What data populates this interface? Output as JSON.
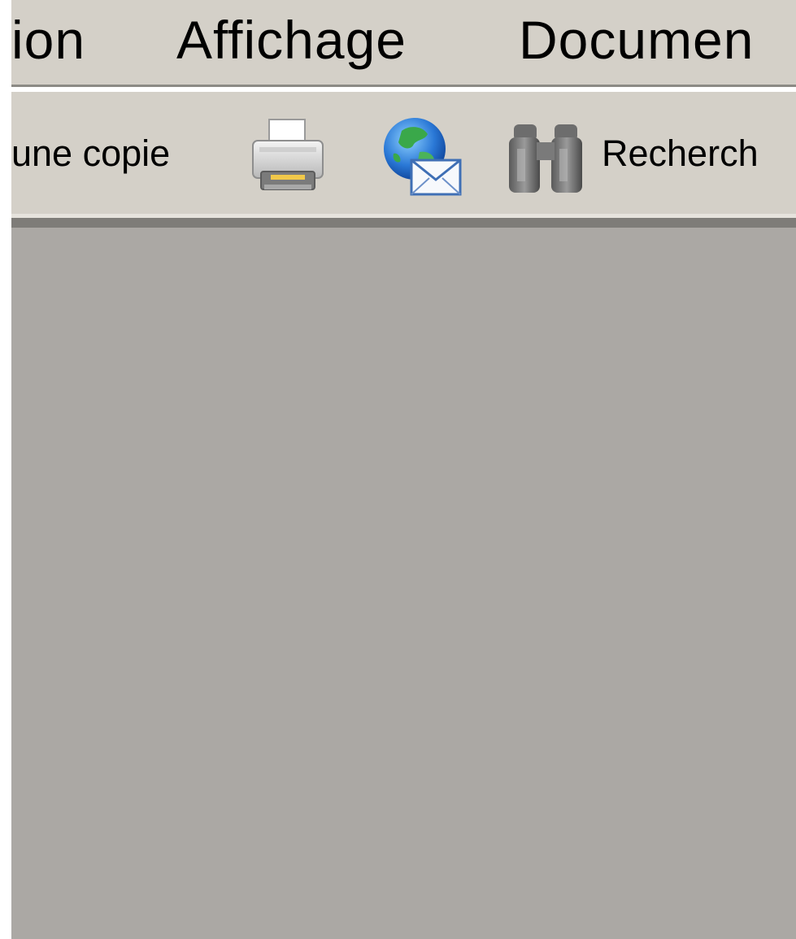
{
  "menubar": {
    "items": [
      {
        "label": "ion"
      },
      {
        "label": "Affichage"
      },
      {
        "label": "Documen"
      }
    ]
  },
  "toolbar": {
    "copy_label": "une copie",
    "print_icon": "printer-icon",
    "email_icon": "globe-email-icon",
    "search_icon": "binoculars-icon",
    "search_label": "Recherch"
  },
  "colors": {
    "chrome": "#d4d0c8",
    "workspace": "#aba8a4"
  }
}
